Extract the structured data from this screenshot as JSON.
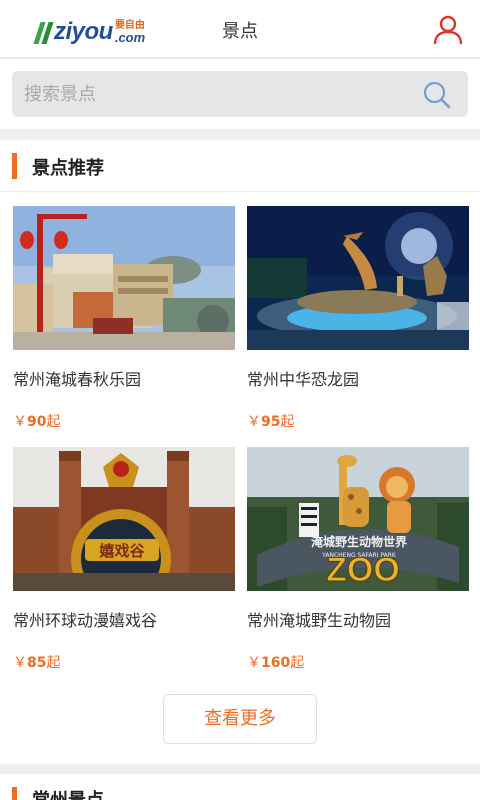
{
  "header": {
    "logo_word": "ziyou",
    "logo_cn": "要自由",
    "logo_domain": ".com",
    "title": "景点",
    "user_icon": "user-icon"
  },
  "search": {
    "placeholder": "搜索景点",
    "icon": "search-icon"
  },
  "recommend": {
    "title": "景点推荐",
    "items": [
      {
        "name": "常州淹城春秋乐园",
        "price_symbol": "￥",
        "price": "90",
        "price_suffix": "起"
      },
      {
        "name": "常州中华恐龙园",
        "price_symbol": "￥",
        "price": "95",
        "price_suffix": "起"
      },
      {
        "name": "常州环球动漫嬉戏谷",
        "price_symbol": "￥",
        "price": "85",
        "price_suffix": "起"
      },
      {
        "name": "常州淹城野生动物园",
        "price_symbol": "￥",
        "price": "160",
        "price_suffix": "起"
      }
    ],
    "more_label": "查看更多"
  },
  "photo_text": {
    "gate_sign": "嬉戏谷",
    "zoo_line1": "淹城野生动物世界",
    "zoo_line2": "YANCHENG SAFARI PARK",
    "zoo_word": "ZOO"
  },
  "local": {
    "title": "常州景点"
  },
  "colors": {
    "accent": "#f36a21",
    "logo_blue": "#1f4e9a",
    "logo_green": "#3aa548"
  }
}
